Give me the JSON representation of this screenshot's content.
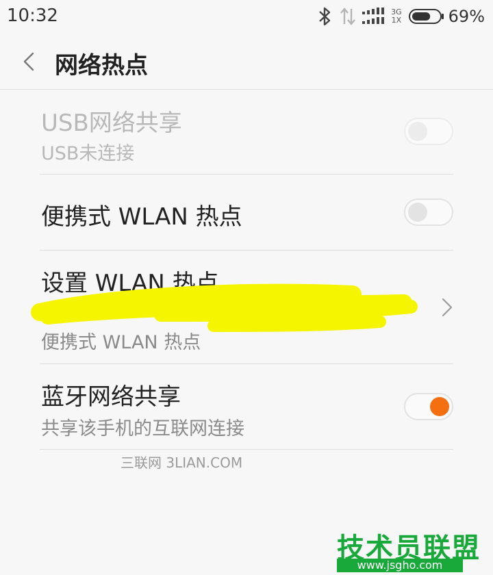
{
  "status_bar": {
    "time": "10:32",
    "network_top": "3G",
    "network_bottom": "1X",
    "battery_percent": "69%",
    "battery_level": 0.69
  },
  "header": {
    "title": "网络热点"
  },
  "rows": [
    {
      "title": "USB网络共享",
      "subtitle": "USB未连接",
      "toggle_on": false,
      "enabled": false
    },
    {
      "title": "便携式 WLAN 热点",
      "toggle_on": false,
      "enabled": true
    },
    {
      "title": "设置 WLAN 热点",
      "subtitle": "便携式 WLAN 热点"
    },
    {
      "title": "蓝牙网络共享",
      "subtitle": "共享该手机的互联网连接",
      "toggle_on": true,
      "enabled": true
    }
  ],
  "colors": {
    "accent": "#f36f10",
    "redaction": "#f5f500",
    "watermark_green": "#18a93a"
  },
  "watermarks": {
    "line1": "三联网 3LIAN.COM",
    "line2": "技术员联盟",
    "line3": "www.jsgho.com"
  },
  "icons": {
    "bluetooth": "bluetooth-icon",
    "data": "data-transfer-icon",
    "signal": "signal-icon",
    "battery": "battery-icon",
    "back": "back-icon",
    "chevron": "chevron-right-icon"
  }
}
